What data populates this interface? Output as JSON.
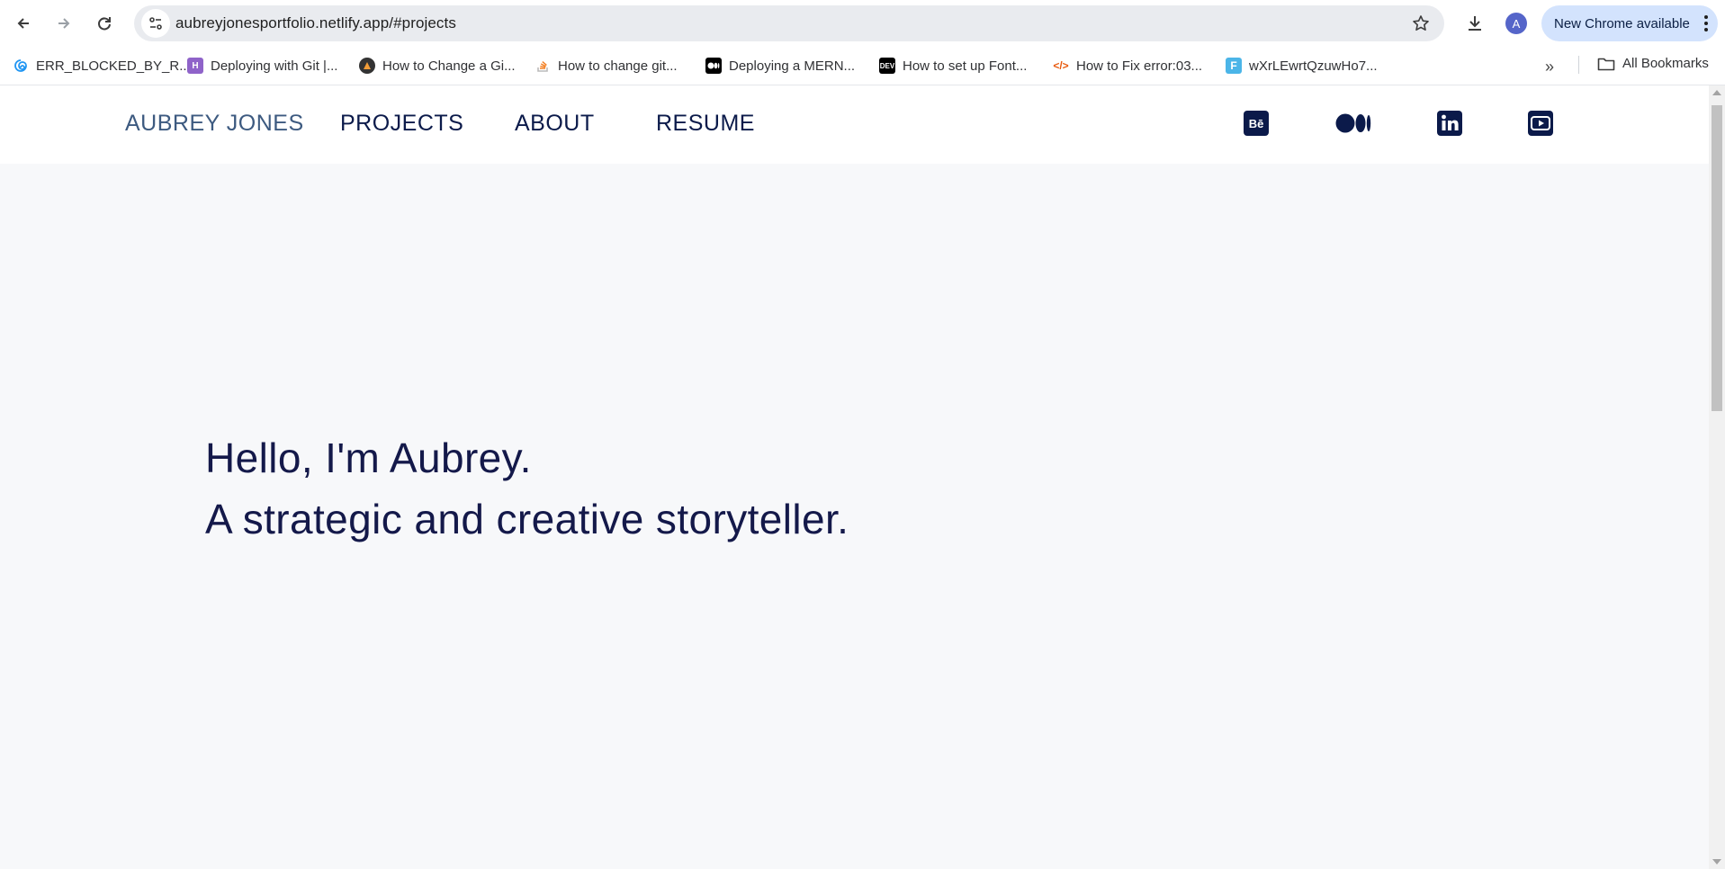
{
  "browser": {
    "url": "aubreyjonesportfolio.netlify.app/#projects",
    "avatar_letter": "A",
    "update_label": "New Chrome available",
    "bookmarks": [
      {
        "label": "ERR_BLOCKED_BY_R...",
        "icon": "swirl-icon",
        "color": "#2196f3"
      },
      {
        "label": "Deploying with Git |...",
        "icon": "heroku-icon",
        "color": "#8f63c9"
      },
      {
        "label": "How to Change a Gi...",
        "icon": "rocket-icon",
        "color": "#333333"
      },
      {
        "label": "How to change git...",
        "icon": "stackoverflow-icon",
        "color": "#f48024"
      },
      {
        "label": "Deploying a MERN...",
        "icon": "medium-icon",
        "color": "#000000"
      },
      {
        "label": "How to set up Font...",
        "icon": "dev-icon",
        "color": "#000000"
      },
      {
        "label": "How to Fix error:03...",
        "icon": "code-icon",
        "color": "#e8590c"
      },
      {
        "label": "wXrLEwrtQzuwHo7...",
        "icon": "f-icon",
        "color": "#4bb5e8"
      }
    ],
    "all_bookmarks_label": "All Bookmarks"
  },
  "site": {
    "brand": "AUBREY JONES",
    "nav": [
      "PROJECTS",
      "ABOUT",
      "RESUME"
    ],
    "social": [
      "behance-icon",
      "medium-icon",
      "linkedin-icon",
      "youtube-icon"
    ],
    "hero_line1": "Hello, I'm Aubrey.",
    "hero_line2": "A strategic and creative storyteller."
  },
  "colors": {
    "brand": "#3d5a80",
    "navy": "#0b1a4a",
    "page_bg": "#f7f8fa"
  }
}
